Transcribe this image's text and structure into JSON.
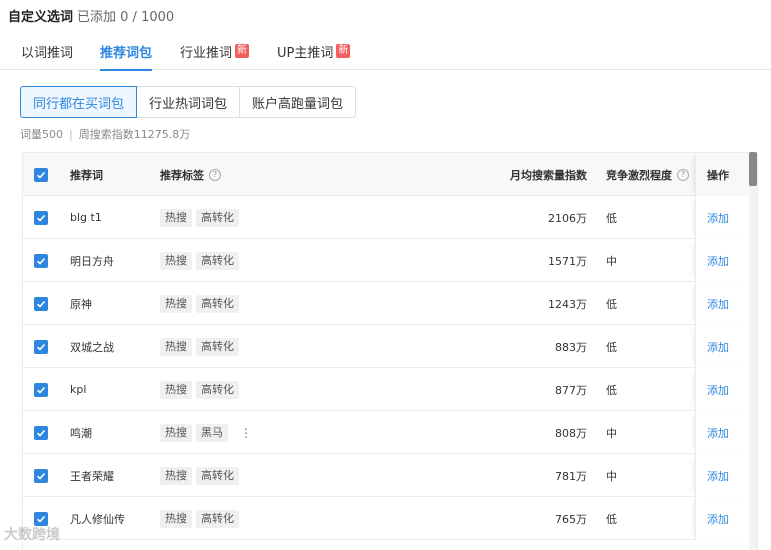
{
  "header": {
    "title": "自定义选词",
    "count": "已添加 0 / 1000"
  },
  "tabs": [
    {
      "label": "以词推词",
      "new": false,
      "active": false
    },
    {
      "label": "推荐词包",
      "new": false,
      "active": true
    },
    {
      "label": "行业推词",
      "new": true,
      "active": false
    },
    {
      "label": "UP主推词",
      "new": true,
      "active": false
    }
  ],
  "new_badge": "新",
  "segments": [
    "同行都在买词包",
    "行业热词词包",
    "账户高跑量词包"
  ],
  "stats": {
    "word_count": "词量500",
    "search_index": "周搜索指数11275.8万"
  },
  "table": {
    "columns": {
      "word": "推荐词",
      "tags": "推荐标签",
      "volume": "月均搜索量指数",
      "competition": "竞争激烈程度",
      "op": "操作"
    },
    "add_label": "添加",
    "rows": [
      {
        "word": "blg t1",
        "tags": [
          "热搜",
          "高转化"
        ],
        "volume": "2106万",
        "competition": "低"
      },
      {
        "word": "明日方舟",
        "tags": [
          "热搜",
          "高转化"
        ],
        "volume": "1571万",
        "competition": "中"
      },
      {
        "word": "原神",
        "tags": [
          "热搜",
          "高转化"
        ],
        "volume": "1243万",
        "competition": "低"
      },
      {
        "word": "双城之战",
        "tags": [
          "热搜",
          "高转化"
        ],
        "volume": "883万",
        "competition": "低"
      },
      {
        "word": "kpl",
        "tags": [
          "热搜",
          "高转化"
        ],
        "volume": "877万",
        "competition": "低"
      },
      {
        "word": "鸣潮",
        "tags": [
          "热搜",
          "黑马"
        ],
        "volume": "808万",
        "competition": "中",
        "more": "⋮"
      },
      {
        "word": "王者荣耀",
        "tags": [
          "热搜",
          "高转化"
        ],
        "volume": "781万",
        "competition": "中"
      },
      {
        "word": "凡人修仙传",
        "tags": [
          "热搜",
          "高转化"
        ],
        "volume": "765万",
        "competition": "低"
      }
    ]
  },
  "watermark": "大数跨境",
  "colors": {
    "accent": "#2e86de",
    "new_badge": "#f25d5d"
  }
}
